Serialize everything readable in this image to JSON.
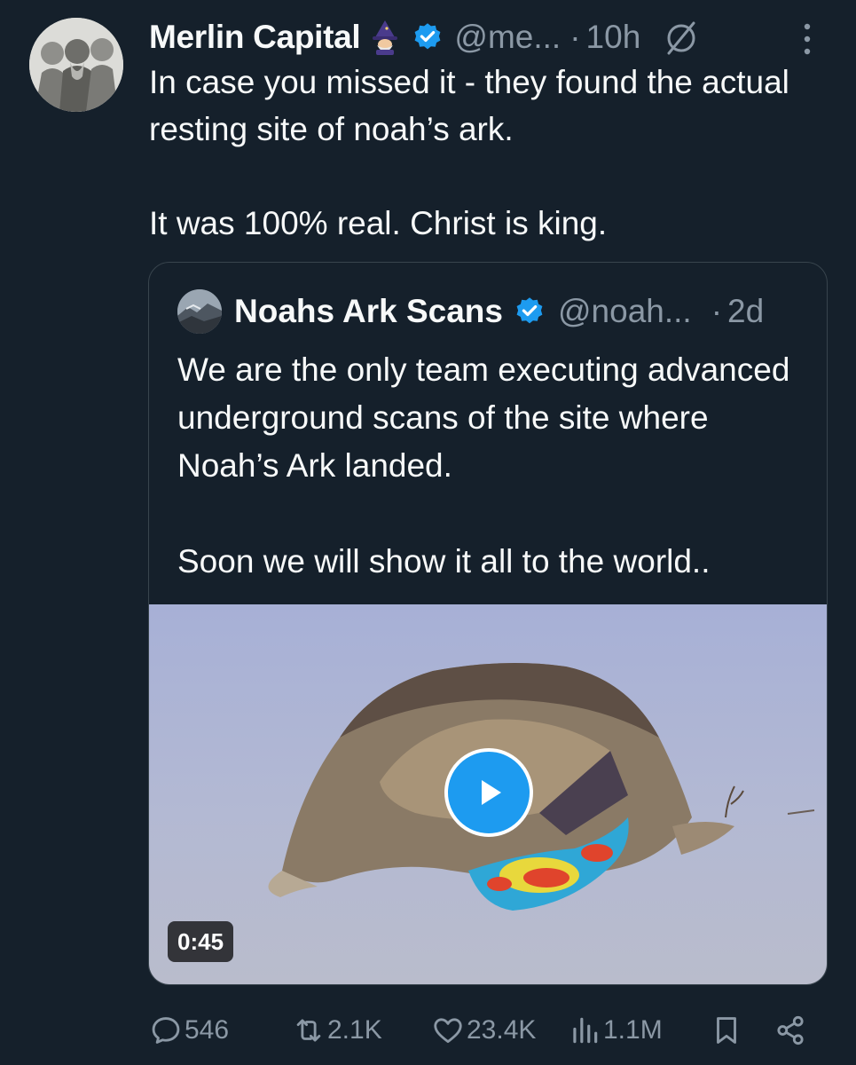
{
  "tweet": {
    "author_name": "Merlin Capital",
    "author_handle": "@me...",
    "dot": "·",
    "time": "10h",
    "paragraphs": [
      "In case you missed it - they found the actual resting site of noah’s ark.",
      "It was 100% real. Christ is king."
    ],
    "icons": {
      "emoji": "mage-emoji-icon",
      "verified": "verified-badge-icon",
      "null": "null-sign-icon",
      "more": "more-vertical-icon"
    }
  },
  "quote": {
    "author_name": "Noahs Ark Scans",
    "author_handle": "@noah...",
    "dot": "·",
    "time": "2d",
    "paragraphs": [
      "We are the only team executing advanced underground scans of the site where Noah’s Ark landed.",
      "Soon we will show it all to the world.."
    ],
    "video": {
      "duration": "0:45",
      "play_icon": "play-icon"
    }
  },
  "actions": {
    "replies": "546",
    "reposts": "2.1K",
    "likes": "23.4K",
    "views": "1.1M",
    "icons": [
      "reply-icon",
      "repost-icon",
      "like-icon",
      "views-icon",
      "bookmark-icon",
      "share-icon"
    ]
  },
  "colors": {
    "background": "#15202b",
    "text": "#f7f9f9",
    "muted": "#8b98a5",
    "accent": "#1d9bf0",
    "border": "#38444d"
  }
}
